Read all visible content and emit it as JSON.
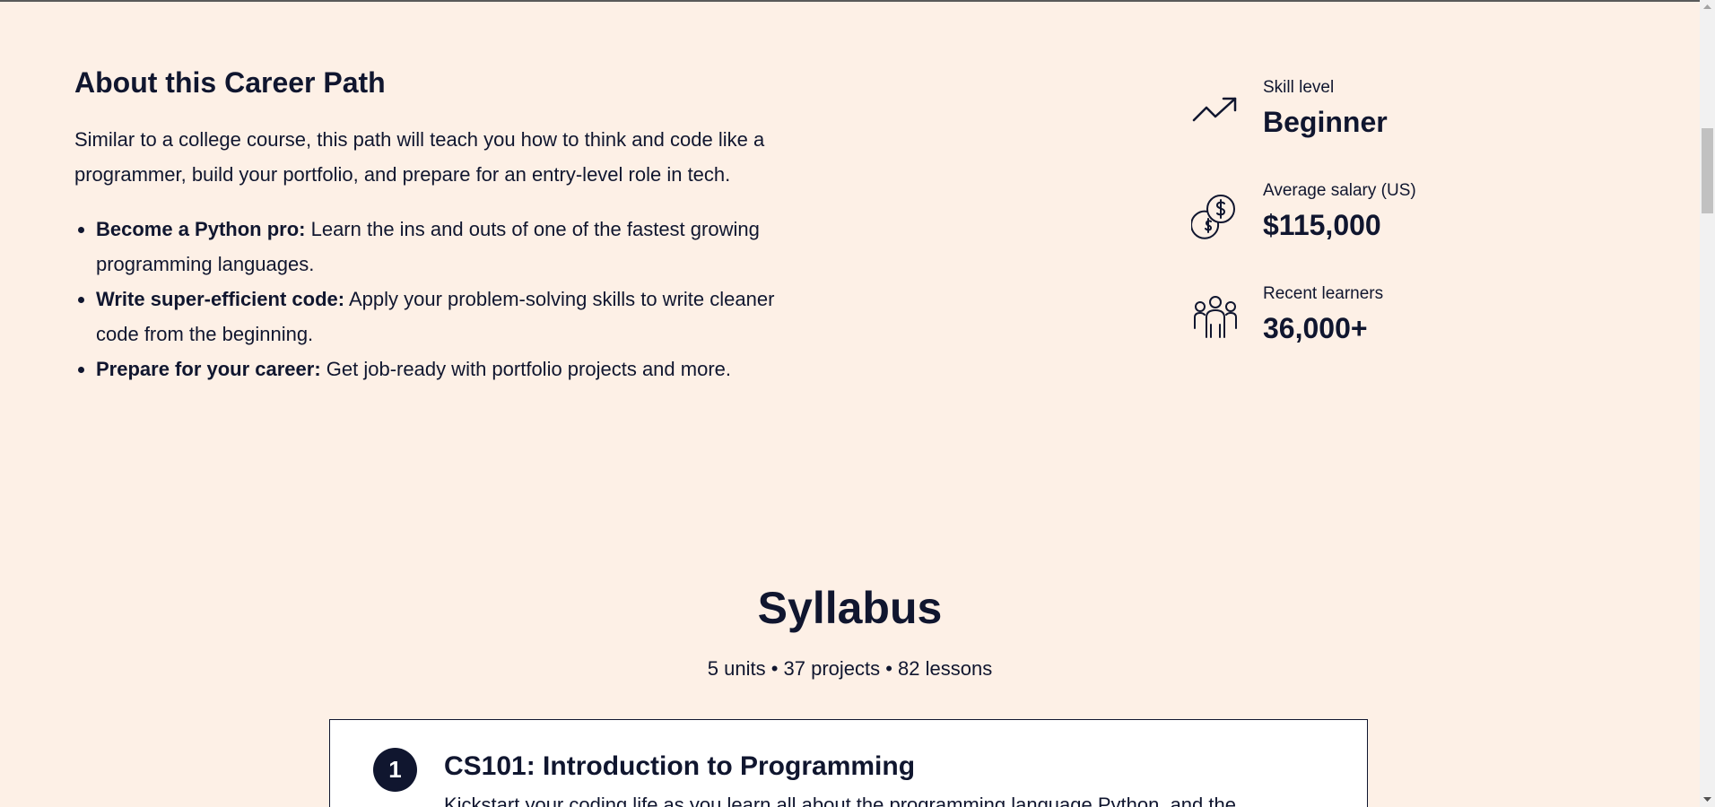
{
  "about": {
    "title": "About this Career Path",
    "intro": "Similar to a college course, this path will teach you how to think and code like a programmer, build your portfolio, and prepare for an entry-level role in tech.",
    "bullets": [
      {
        "bold": "Become a Python pro:",
        "text": " Learn the ins and outs of one of the fastest growing programming languages."
      },
      {
        "bold": "Write super-efficient code:",
        "text": " Apply your problem-solving skills to write cleaner code from the beginning."
      },
      {
        "bold": "Prepare for your career:",
        "text": " Get job-ready with portfolio projects and more."
      }
    ]
  },
  "stats": [
    {
      "icon": "trending-up-icon",
      "label": "Skill level",
      "value": "Beginner"
    },
    {
      "icon": "coins-dollar-icon",
      "label": "Average salary (US)",
      "value": "$115,000"
    },
    {
      "icon": "people-group-icon",
      "label": "Recent learners",
      "value": "36,000+"
    }
  ],
  "syllabus": {
    "title": "Syllabus",
    "meta": "5 units • 37 projects • 82 lessons",
    "units": [
      {
        "number": "1",
        "title": "CS101: Introduction to Programming",
        "description": "Kickstart your coding life as you learn all about the programming language Python, and the"
      }
    ]
  },
  "colors": {
    "background": "#fdf0e6",
    "text": "#10162f",
    "card": "#ffffff"
  }
}
